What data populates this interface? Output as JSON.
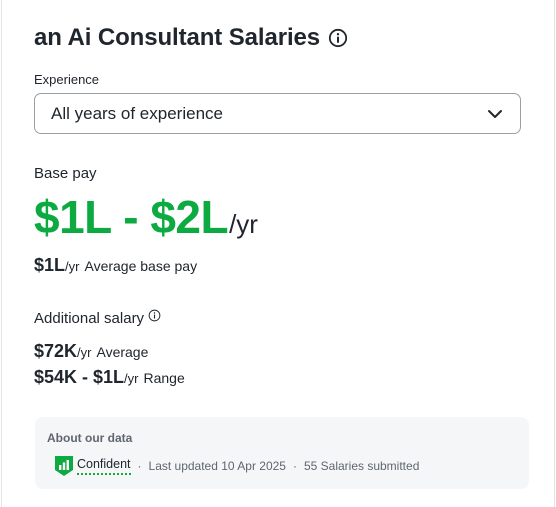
{
  "header": {
    "title": "an Ai Consultant Salaries"
  },
  "experience": {
    "label": "Experience",
    "selected": "All years of experience"
  },
  "base_pay": {
    "label": "Base pay",
    "range": "$1L - $2L",
    "range_unit": "/yr",
    "average_value": "$1L",
    "average_unit": "/yr",
    "average_caption": "Average base pay"
  },
  "additional_salary": {
    "label": "Additional salary",
    "average_value": "$72K",
    "average_unit": "/yr",
    "average_caption": "Average",
    "range_value": "$54K - $1L",
    "range_unit": "/yr",
    "range_caption": "Range"
  },
  "about": {
    "title": "About our data",
    "confidence": "Confident",
    "separator": "·",
    "last_updated": "Last updated 10 Apr 2025",
    "salaries_submitted": "55 Salaries submitted"
  },
  "colors": {
    "accent_green": "#0caa41",
    "text_dark": "#20262e",
    "text_muted": "#5f6670",
    "box_bg": "#f5f6f7"
  },
  "icons": {
    "title_info": "info-icon",
    "dropdown": "chevron-down-icon",
    "additional_info": "info-icon",
    "confidence": "signal-shield-icon"
  }
}
